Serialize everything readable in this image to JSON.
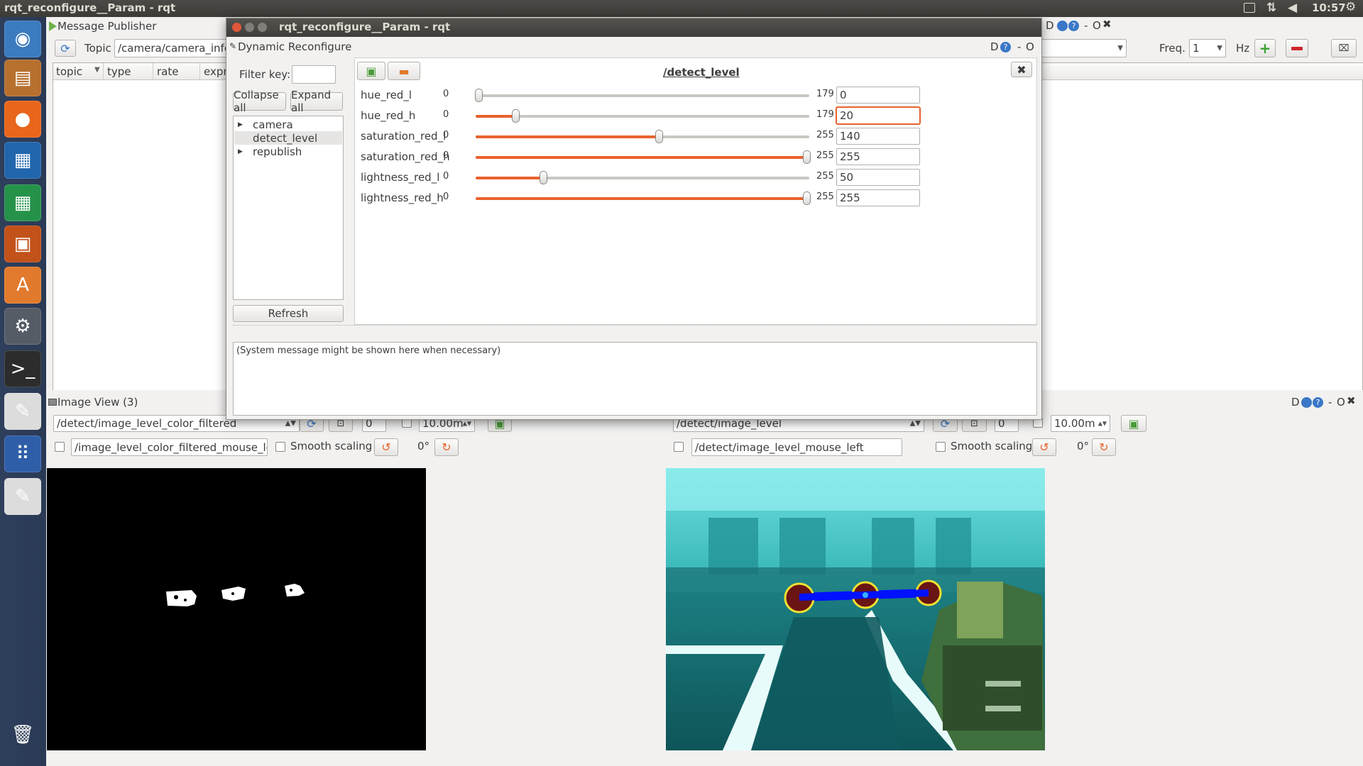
{
  "top_panel": {
    "title": "rqt_reconfigure__Param - rqt",
    "time": "10:57"
  },
  "launcher": {
    "items": [
      {
        "name": "ubuntu-dash-icon",
        "glyph": "◉",
        "color": "#3b7bbf"
      },
      {
        "name": "files-icon",
        "glyph": "▤",
        "color": "#b7702e"
      },
      {
        "name": "firefox-icon",
        "glyph": "●",
        "color": "#e8651c"
      },
      {
        "name": "writer-icon",
        "glyph": "▦",
        "color": "#2166ad"
      },
      {
        "name": "calc-icon",
        "glyph": "▦",
        "color": "#25924a"
      },
      {
        "name": "impress-icon",
        "glyph": "▣",
        "color": "#c2511a"
      },
      {
        "name": "software-center-icon",
        "glyph": "A",
        "color": "#e27a2d"
      },
      {
        "name": "system-settings-icon",
        "glyph": "⚙",
        "color": "#555c66"
      },
      {
        "name": "terminal-icon",
        "glyph": ">_",
        "color": "#2c2c2c"
      },
      {
        "name": "text-editor-icon",
        "glyph": "✎",
        "color": "#dcdcdc"
      },
      {
        "name": "apps-grid-icon",
        "glyph": "⠿",
        "color": "#2f5ea8"
      },
      {
        "name": "text-editor-2-icon",
        "glyph": "✎",
        "color": "#dcdcdc"
      },
      {
        "name": "trash-icon",
        "glyph": "🗑",
        "color": "#8f9398"
      }
    ]
  },
  "publisher": {
    "title": "Message Publisher",
    "topic_label": "Topic",
    "topic_value": "/camera/camera_info",
    "freq_label": "Freq.",
    "freq_value": "1",
    "hz_label": "Hz",
    "columns": [
      "topic",
      "type",
      "rate",
      "expr"
    ],
    "window_controls": "D",
    "close_label": "O"
  },
  "dialog": {
    "title": "rqt_reconfigure__Param - rqt",
    "plugin_title": "Dynamic Reconfigure",
    "filter_label": "Filter key:",
    "filter_value": "",
    "collapse_label": "Collapse all",
    "expand_label": "Expand all",
    "tree": [
      "camera",
      "detect_level",
      "republish"
    ],
    "refresh_label": "Refresh",
    "node_title": "/detect_level",
    "system_message": "(System message might be shown here when necessary)",
    "params": [
      {
        "name": "hue_red_l",
        "min": "0",
        "max": "179",
        "value": "0",
        "level": 0.0
      },
      {
        "name": "hue_red_h",
        "min": "0",
        "max": "179",
        "value": "20",
        "level": 0.112
      },
      {
        "name": "saturation_red_l",
        "min": "0",
        "max": "255",
        "value": "140",
        "level": 0.549
      },
      {
        "name": "saturation_red_h",
        "min": "0",
        "max": "255",
        "value": "255",
        "level": 1.0
      },
      {
        "name": "lightness_red_l",
        "min": "0",
        "max": "255",
        "value": "50",
        "level": 0.196
      },
      {
        "name": "lightness_red_h",
        "min": "0",
        "max": "255",
        "value": "255",
        "level": 1.0
      }
    ]
  },
  "image_view": {
    "title": "Image View (3)",
    "left": {
      "topic": "/detect/image_level_color_filtered",
      "spin": "0",
      "range": "10.00m",
      "mouse_topic": "/image_level_color_filtered_mouse_left",
      "smooth_label": "Smooth scaling",
      "rotation": "0°"
    },
    "right": {
      "topic": "/detect/image_level",
      "spin": "0",
      "range": "10.00m",
      "mouse_topic": "/detect/image_level_mouse_left",
      "smooth_label": "Smooth scaling",
      "rotation": "0°"
    }
  },
  "colors": {
    "slider_accent": "#e9622e",
    "focus_border": "#e9622e",
    "launcher_bg": "#2e3f5c"
  }
}
